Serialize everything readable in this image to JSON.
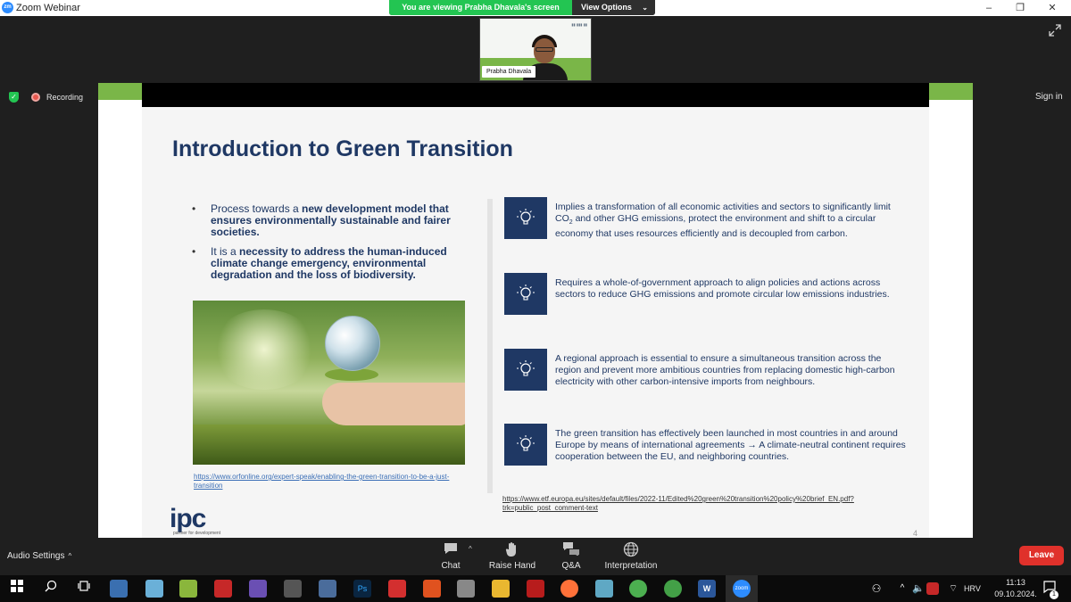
{
  "window": {
    "app_title": "Zoom Webinar",
    "logo_text": "zm",
    "minimize": "–",
    "restore": "❐",
    "close": "✕"
  },
  "share_banner": {
    "status_text": "You are viewing Prabha Dhavala's screen",
    "view_options_label": "View Options",
    "view_options_chevron": "⌄"
  },
  "speaker": {
    "name": "Prabha Dhavala"
  },
  "recording": {
    "label": "Recording"
  },
  "sign_in_label": "Sign in",
  "slide": {
    "title": "Introduction to Green Transition",
    "bullets": [
      {
        "prefix": "Process towards a ",
        "bold": "new development model that ensures environmentally sustainable and fairer societies.",
        "suffix": ""
      },
      {
        "prefix": "It is a ",
        "bold": "necessity to address the human-induced climate change emergency, environmental degradation and the loss of biodiversity.",
        "suffix": ""
      }
    ],
    "image_link": "https://www.orfonline.org/expert-speak/enabling-the-green-transition-to-be-a-just-transition",
    "cards": [
      {
        "text_before_sub": "Implies a transformation of all economic activities and sectors to significantly limit CO",
        "sub": "2",
        "text_after_sub": " and other GHG emissions, protect the environment and shift to a circular economy that uses resources efficiently and is decoupled from carbon."
      },
      {
        "text": "Requires a whole-of-government approach to align policies and actions across sectors to reduce GHG emissions and promote circular low emissions industries."
      },
      {
        "text": "A regional approach is essential to ensure a simultaneous transition across the region and prevent more ambitious countries from replacing domestic high-carbon electricity with other carbon-intensive imports from neighbours."
      },
      {
        "text": "The green transition has effectively been launched in most countries in and around Europe by means of international agreements → A climate-neutral continent requires cooperation between the EU, and neighboring countries."
      }
    ],
    "source_link": "https://www.etf.europa.eu/sites/default/files/2022-11/Edited%20green%20transition%20policy%20brief_EN.pdf?trk=public_post_comment-text",
    "logo_text": "ipc",
    "logo_tagline": "partner for development",
    "page_number": "4"
  },
  "controls": {
    "audio_settings": "Audio Settings",
    "audio_caret": "^",
    "chat": "Chat",
    "chat_caret": "^",
    "raise_hand": "Raise Hand",
    "qa": "Q&A",
    "interpretation": "Interpretation",
    "leave": "Leave"
  },
  "taskbar": {
    "language": "HRV",
    "time": "11:13",
    "date": "09.10.2024.",
    "notification_count": "1"
  },
  "colors": {
    "slide_navy": "#1f3864",
    "slide_green": "#7ab648",
    "leave_red": "#e0312b",
    "banner_green": "#23c552"
  }
}
